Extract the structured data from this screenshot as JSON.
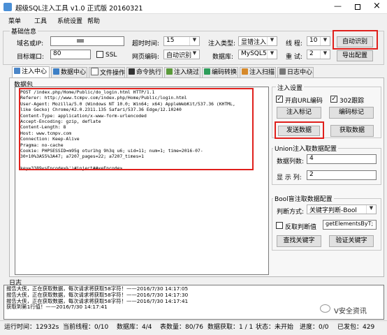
{
  "title": "超级SQL注入工具 v1.0 正式版 20160321",
  "menu": [
    "菜单",
    "工具",
    "系统设置",
    "帮助"
  ],
  "basic": {
    "group_label": "基础信息",
    "domain_label": "域名或IP:",
    "domain_value": "",
    "timeout_label": "超时时间:",
    "timeout_value": "15",
    "inject_type_label": "注入类型:",
    "inject_type_value": "显错注入",
    "threads_label": "线 程:",
    "threads_value": "10",
    "auto_detect_btn": "自动识别",
    "port_label": "目标端口:",
    "port_value": "80",
    "ssl_label": "SSL",
    "encoding_label": "网页编码:",
    "encoding_value": "自动识别",
    "db_label": "数据库:",
    "db_value": "MySQL5",
    "retry_label": "重 试:",
    "retry_value": "2",
    "export_btn": "导出配置"
  },
  "tabs": [
    "注入中心",
    "数据中心",
    "文件操作",
    "命令执行",
    "注入绕过",
    "编码转换",
    "注入扫描",
    "日志中心"
  ],
  "packet": {
    "label": "数据包",
    "lines": [
      "POST /index.php/Home/Public/do_login.html HTTP/1.1",
      "Referer: http://www.tcmpv.com/index.php/Home/Public/login.html",
      "User-Agent: Mozilla/5.0 (Windows NT 10.0; Win64; x64) AppleWebKit/537.36 (KHTML,",
      "like Gecko) Chrome/42.0.2311.135 Safari/537.36 Edge/12.10240",
      "Content-Type: application/x-www-form-urlencoded",
      "Accept-Encoding: gzip, deflate",
      "Content-Length: 8",
      "Host: www.tcmpv.com",
      "Connection: Keep-Alive",
      "Pragma: no-cache",
      "Cookie: PHPSESSID=m95g    otur1hg   9h3q   u6; uid=11; num=1; time=2016-07-",
      "30+10%3A55%3A47; a7207_pages=22; a7207_times=1",
      "",
      "key=3389<sEncode>%')#inject##<eEncode>"
    ]
  },
  "settings": {
    "group_label": "注入设置",
    "urlencode_label": "开启URL编码",
    "urlencode_checked": true,
    "follow302_label": "302跟踪",
    "follow302_checked": true,
    "inject_mark_btn": "注入标记",
    "encode_mark_btn": "编码标记",
    "send_data_btn": "发送数据",
    "get_data_btn": "获取数据"
  },
  "union": {
    "group_label": "Union注入取数据配置",
    "cols_label": "数据列数:",
    "cols_value": "4",
    "display_label": "显 示 列:",
    "display_value": "2"
  },
  "bool": {
    "group_label": "Bool盲注取数据配置",
    "judge_label": "判断方式:",
    "judge_value": "关键字判断-Bool",
    "reverse_label": "反取判断值",
    "reverse_checked": false,
    "func_value": "getElementsByT;",
    "find_kw_btn": "查找关键字",
    "verify_kw_btn": "验证关键字"
  },
  "log": {
    "label": "日志",
    "lines": [
      "报告大侠，正在获取数据，每次请求将获取58字符！——2016/7/30 14:17:05",
      "报告大侠，正在获取数据，每次请求将获取58字符！——2016/7/30 14:17:30",
      "报告大侠，正在获取数据，每次请求将获取58字符！——2016/7/30 14:17:41",
      "获取到第1行值！——2016/7/30 14:17:41"
    ],
    "watermark": "V安全资讯"
  },
  "status": {
    "runtime_label": "运行时间：",
    "runtime_value": "12932s",
    "curdb_label": "当前线程：",
    "curdb_value": "0/10",
    "dbcount_label": "数据库：",
    "dbcount_value": "4/4",
    "tables_label": "表数量：",
    "tables_value": "80/76",
    "datacount_label": "数据获取：",
    "datacount_value": "1 / 1",
    "state_label": "状态：",
    "state_value": "未开始",
    "progress_label": "进度：",
    "progress_value": "0/0",
    "sent_label": "已发包：",
    "sent_value": "429"
  },
  "colors": {
    "highlight": "#e0201c",
    "titlebar": "#ffffff",
    "wechat": "#07c160"
  }
}
